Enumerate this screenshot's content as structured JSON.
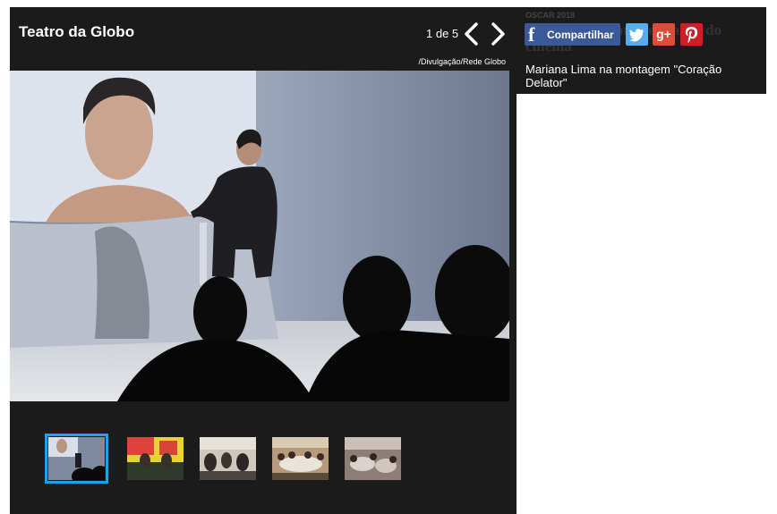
{
  "gallery": {
    "title": "Teatro da Globo",
    "counter": "1 de 5",
    "credit": "/Divulgação/Rede Globo",
    "thumbnails": [
      {
        "alt": "thumb-1"
      },
      {
        "alt": "thumb-2"
      },
      {
        "alt": "thumb-3"
      },
      {
        "alt": "thumb-4"
      },
      {
        "alt": "thumb-5"
      }
    ],
    "active_thumb": 1
  },
  "side": {
    "tag": "OSCAR 2018",
    "headline": "... sobre a maior premiação do cinema",
    "caption": "Mariana Lima na montagem \"Coração Delator\"",
    "share": {
      "facebook_label": "Compartilhar",
      "facebook_glyph": "f",
      "googleplus_glyph": "g+"
    }
  },
  "colors": {
    "panel": "#1b1b1b",
    "active_outline": "#1fa3e6",
    "facebook": "#3b5998",
    "twitter": "#55acee",
    "googleplus": "#dd4b39",
    "pinterest": "#cb2027"
  }
}
